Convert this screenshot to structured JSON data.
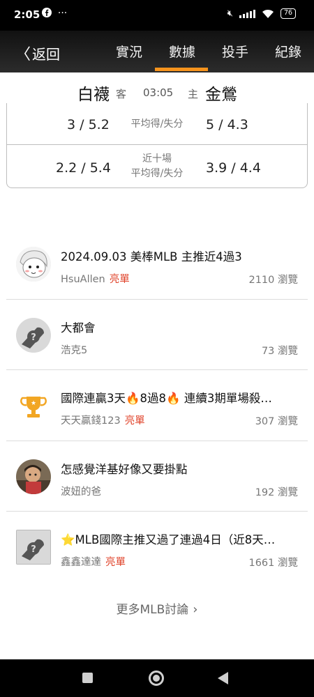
{
  "status_bar": {
    "time": "2:05",
    "app_icons": " ⋯",
    "battery": "76"
  },
  "nav": {
    "back_label": "返回",
    "tabs": [
      "實況",
      "數據",
      "投手",
      "紀錄"
    ],
    "active_tab": "數據",
    "accent_color": "#f7941d"
  },
  "match": {
    "away_team": "白襪",
    "away_tag": "客",
    "time": "03:05",
    "home_tag": "主",
    "home_team": "金鶯"
  },
  "stats": {
    "rows": [
      {
        "left": "3 / 5.2",
        "label_line1": "平均得/失分",
        "label_line2": "",
        "right": "5 / 4.3"
      },
      {
        "left": "2.2 / 5.4",
        "label_line1": "近十場",
        "label_line2": "平均得/失分",
        "right": "3.9 / 4.4"
      }
    ]
  },
  "discussions": [
    {
      "title": "2024.09.03 美棒MLB 主推近4過3",
      "author": "HsuAllen",
      "badge": "亮單",
      "views": "2110 瀏覽",
      "avatar": "anime-avatar"
    },
    {
      "title": "大都會",
      "author": "浩克5",
      "badge": "",
      "views": "73 瀏覽",
      "avatar": "default-avatar"
    },
    {
      "title": "國際連贏3天🔥8過8🔥 連續3期單場殺…",
      "author": "天天贏錢123",
      "badge": "亮單",
      "views": "307 瀏覽",
      "avatar": "trophy-icon"
    },
    {
      "title": "怎感覺洋基好像又要掛點",
      "author": "波妞的爸",
      "badge": "",
      "views": "192 瀏覽",
      "avatar": "photo-avatar"
    },
    {
      "title": "⭐MLB國際主推又過了連過4日（近8天…",
      "author": "鑫鑫達達",
      "badge": "亮單",
      "views": "1661 瀏覽",
      "avatar": "default-avatar-square"
    }
  ],
  "more_link": "更多MLB討論",
  "colors": {
    "hot_badge": "#e0442b",
    "divider": "#dcdcdc"
  }
}
